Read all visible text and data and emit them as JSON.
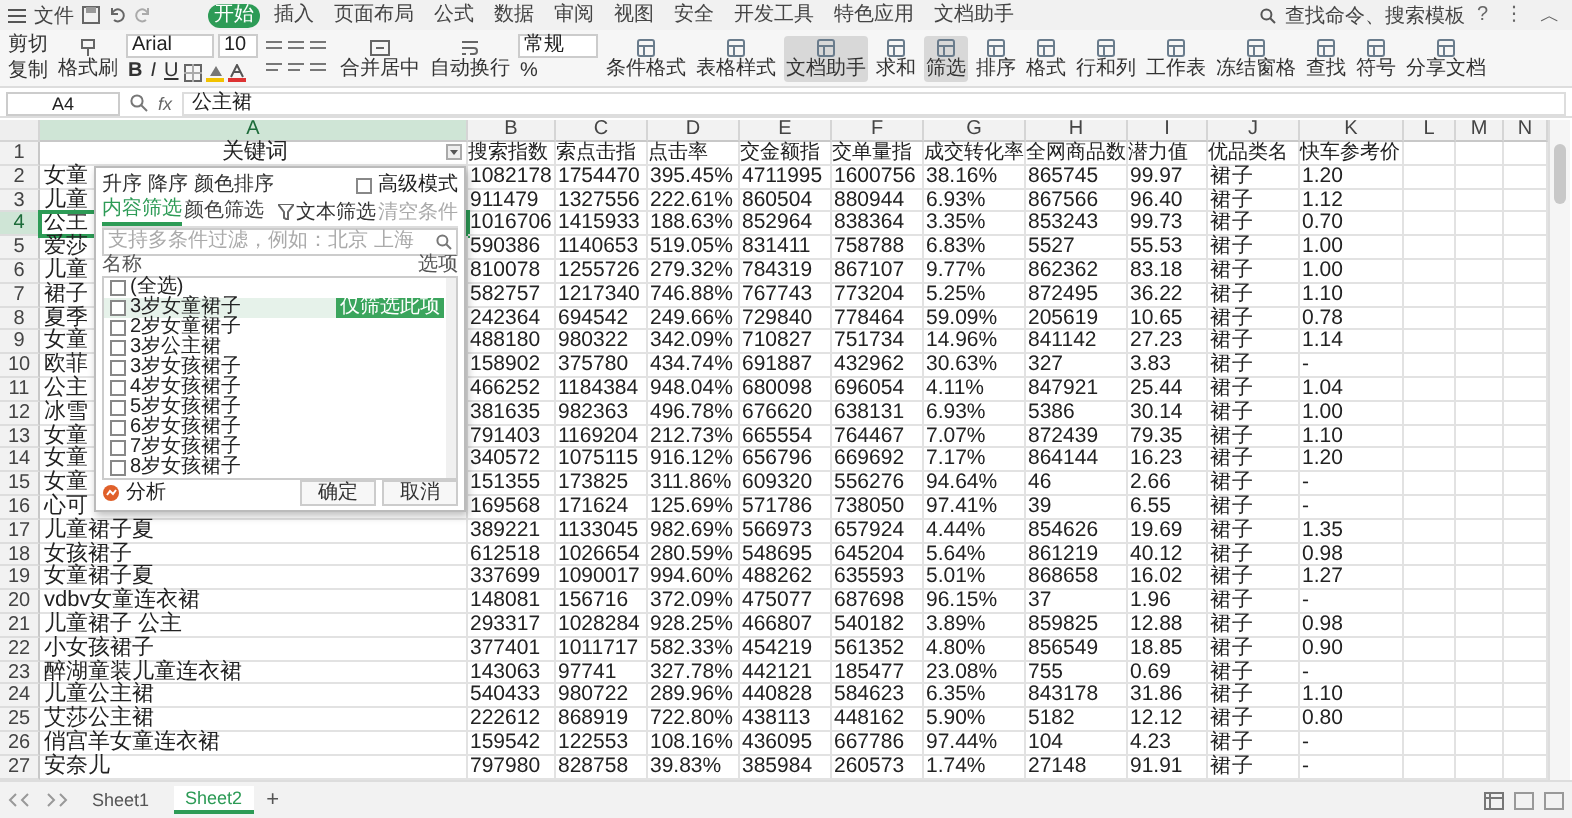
{
  "menu": {
    "file": "文件",
    "tabs": [
      {
        "label": "开始",
        "selected": true
      },
      {
        "label": "插入",
        "selected": false
      },
      {
        "label": "页面布局",
        "selected": false
      },
      {
        "label": "公式",
        "selected": false
      },
      {
        "label": "数据",
        "selected": false
      },
      {
        "label": "审阅",
        "selected": false
      },
      {
        "label": "视图",
        "selected": false
      },
      {
        "label": "安全",
        "selected": false
      },
      {
        "label": "开发工具",
        "selected": false
      },
      {
        "label": "特色应用",
        "selected": false
      },
      {
        "label": "文档助手",
        "selected": false
      }
    ],
    "search": "查找命令、搜索模板",
    "controls": [
      "?",
      "⋮",
      "︿"
    ]
  },
  "ribbon": {
    "clipboard": [
      "剪切",
      "复制"
    ],
    "format_painter": "格式刷",
    "font": {
      "name": "Arial",
      "size": "10"
    },
    "styles": [
      "B",
      "I",
      "U"
    ],
    "merge": "合并居中",
    "wrap": "自动换行",
    "number_format": "常规",
    "number_buttons": [
      "%"
    ],
    "tools": [
      {
        "label": "条件格式",
        "pressed": false
      },
      {
        "label": "表格样式",
        "pressed": false
      },
      {
        "label": "文档助手",
        "pressed": true
      },
      {
        "label": "求和",
        "pressed": false
      },
      {
        "label": "筛选",
        "pressed": true
      },
      {
        "label": "排序",
        "pressed": false
      },
      {
        "label": "格式",
        "pressed": false
      },
      {
        "label": "行和列",
        "pressed": false
      },
      {
        "label": "工作表",
        "pressed": false
      },
      {
        "label": "冻结窗格",
        "pressed": false
      },
      {
        "label": "查找",
        "pressed": false
      },
      {
        "label": "符号",
        "pressed": false
      },
      {
        "label": "分享文档",
        "pressed": false
      }
    ]
  },
  "formula_bar": {
    "name_box": "A4",
    "fx": "fx",
    "value": "公主裙"
  },
  "sheet": {
    "columns": [
      {
        "label": "A",
        "selected": true
      },
      {
        "label": "B",
        "selected": false
      },
      {
        "label": "C",
        "selected": false
      },
      {
        "label": "D",
        "selected": false
      },
      {
        "label": "E",
        "selected": false
      },
      {
        "label": "F",
        "selected": false
      },
      {
        "label": "G",
        "selected": false
      },
      {
        "label": "H",
        "selected": false
      },
      {
        "label": "I",
        "selected": false
      },
      {
        "label": "J",
        "selected": false
      },
      {
        "label": "K",
        "selected": false
      },
      {
        "label": "L",
        "selected": false
      },
      {
        "label": "M",
        "selected": false
      },
      {
        "label": "N",
        "selected": false
      }
    ],
    "rows": [
      {
        "n": "1",
        "selected": false,
        "cells": [
          "关键词",
          "搜索指数",
          "索点击指",
          "点击率",
          "交金额指",
          "交单量指",
          "成交转化率",
          "全网商品数",
          "潜力值",
          "优品类名",
          "快车参考价"
        ]
      },
      {
        "n": "2",
        "selected": false,
        "cells": [
          "女童",
          "1082178",
          "1754470",
          "395.45%",
          "4711995",
          "1600756",
          "38.16%",
          "865745",
          "99.97",
          "裙子",
          "1.20"
        ]
      },
      {
        "n": "3",
        "selected": false,
        "cells": [
          "儿童",
          "911479",
          "1327556",
          "222.61%",
          "860504",
          "880944",
          "6.93%",
          "867566",
          "96.40",
          "裙子",
          "1.12"
        ]
      },
      {
        "n": "4",
        "selected": true,
        "cells": [
          "公主",
          "1016706",
          "1415933",
          "188.63%",
          "852964",
          "838364",
          "3.35%",
          "853243",
          "99.73",
          "裙子",
          "0.70"
        ]
      },
      {
        "n": "5",
        "selected": false,
        "cells": [
          "爱莎",
          "590386",
          "1140653",
          "519.05%",
          "831411",
          "758788",
          "6.83%",
          "5527",
          "55.53",
          "裙子",
          "1.00"
        ]
      },
      {
        "n": "6",
        "selected": false,
        "cells": [
          "儿童",
          "810078",
          "1255726",
          "279.32%",
          "784319",
          "867107",
          "9.77%",
          "862362",
          "83.18",
          "裙子",
          "1.00"
        ]
      },
      {
        "n": "7",
        "selected": false,
        "cells": [
          "裙子",
          "582757",
          "1217340",
          "746.88%",
          "767743",
          "773204",
          "5.25%",
          "872495",
          "36.22",
          "裙子",
          "1.10"
        ]
      },
      {
        "n": "8",
        "selected": false,
        "cells": [
          "夏季",
          "242364",
          "694542",
          "249.66%",
          "729840",
          "778464",
          "59.09%",
          "205619",
          "10.65",
          "裙子",
          "0.78"
        ]
      },
      {
        "n": "9",
        "selected": false,
        "cells": [
          "女童",
          "488180",
          "980322",
          "342.09%",
          "710827",
          "751734",
          "14.96%",
          "841142",
          "27.23",
          "裙子",
          "1.14"
        ]
      },
      {
        "n": "10",
        "selected": false,
        "cells": [
          "欧菲",
          "158902",
          "375780",
          "434.74%",
          "691887",
          "432962",
          "30.63%",
          "327",
          "3.83",
          "裙子",
          "-"
        ]
      },
      {
        "n": "11",
        "selected": false,
        "cells": [
          "公主",
          "466252",
          "1184384",
          "948.04%",
          "680098",
          "696054",
          "4.11%",
          "847921",
          "25.44",
          "裙子",
          "1.04"
        ]
      },
      {
        "n": "12",
        "selected": false,
        "cells": [
          "冰雪",
          "381635",
          "982363",
          "496.78%",
          "676620",
          "638131",
          "6.93%",
          "5386",
          "30.14",
          "裙子",
          "1.00"
        ]
      },
      {
        "n": "13",
        "selected": false,
        "cells": [
          "女童",
          "791403",
          "1169204",
          "212.73%",
          "665554",
          "764467",
          "7.07%",
          "872439",
          "79.35",
          "裙子",
          "1.10"
        ]
      },
      {
        "n": "14",
        "selected": false,
        "cells": [
          "女童",
          "340572",
          "1075115",
          "916.12%",
          "656796",
          "669692",
          "7.17%",
          "864144",
          "16.23",
          "裙子",
          "1.20"
        ]
      },
      {
        "n": "15",
        "selected": false,
        "cells": [
          "女童",
          "151355",
          "173825",
          "311.86%",
          "609320",
          "556276",
          "94.64%",
          "46",
          "2.66",
          "裙子",
          "-"
        ]
      },
      {
        "n": "16",
        "selected": false,
        "cells": [
          "心可",
          "169568",
          "171624",
          "125.69%",
          "571786",
          "738050",
          "97.41%",
          "39",
          "6.55",
          "裙子",
          "-"
        ]
      },
      {
        "n": "17",
        "selected": false,
        "cells": [
          "儿童裙子夏",
          "389221",
          "1133045",
          "982.69%",
          "566973",
          "657924",
          "4.44%",
          "854626",
          "19.69",
          "裙子",
          "1.35"
        ]
      },
      {
        "n": "18",
        "selected": false,
        "cells": [
          "女孩裙子",
          "612518",
          "1026654",
          "280.59%",
          "548695",
          "645204",
          "5.64%",
          "861219",
          "40.12",
          "裙子",
          "0.98"
        ]
      },
      {
        "n": "19",
        "selected": false,
        "cells": [
          "女童裙子夏",
          "337699",
          "1090017",
          "994.60%",
          "488262",
          "635593",
          "5.01%",
          "868658",
          "16.02",
          "裙子",
          "1.27"
        ]
      },
      {
        "n": "20",
        "selected": false,
        "cells": [
          "vdbv女童连衣裙",
          "148081",
          "156716",
          "372.09%",
          "475077",
          "687698",
          "96.15%",
          "37",
          "1.96",
          "裙子",
          "-"
        ]
      },
      {
        "n": "21",
        "selected": false,
        "cells": [
          "儿童裙子 公主",
          "293317",
          "1028284",
          "928.25%",
          "466807",
          "540182",
          "3.89%",
          "859825",
          "12.88",
          "裙子",
          "0.98"
        ]
      },
      {
        "n": "22",
        "selected": false,
        "cells": [
          "小女孩裙子",
          "377401",
          "1011717",
          "582.33%",
          "454219",
          "561352",
          "4.80%",
          "856549",
          "18.85",
          "裙子",
          "0.90"
        ]
      },
      {
        "n": "23",
        "selected": false,
        "cells": [
          "醉湖童装儿童连衣裙",
          "143063",
          "97741",
          "327.78%",
          "442121",
          "185477",
          "23.08%",
          "755",
          "0.69",
          "裙子",
          "-"
        ]
      },
      {
        "n": "24",
        "selected": false,
        "cells": [
          "儿童公主裙",
          "540433",
          "980722",
          "289.96%",
          "440828",
          "584623",
          "6.35%",
          "843178",
          "31.86",
          "裙子",
          "1.10"
        ]
      },
      {
        "n": "25",
        "selected": false,
        "cells": [
          "艾莎公主裙",
          "222612",
          "868919",
          "722.80%",
          "438113",
          "448162",
          "5.90%",
          "5182",
          "12.12",
          "裙子",
          "0.80"
        ]
      },
      {
        "n": "26",
        "selected": false,
        "cells": [
          "俏宫羊女童连衣裙",
          "159542",
          "122553",
          "108.16%",
          "436095",
          "667786",
          "97.44%",
          "104",
          "4.23",
          "裙子",
          "-"
        ]
      },
      {
        "n": "27",
        "selected": false,
        "cells": [
          "安奈儿",
          "797980",
          "828758",
          "39.83%",
          "385984",
          "260573",
          "1.74%",
          "27148",
          "91.91",
          "裙子",
          "-"
        ]
      }
    ]
  },
  "filter_popup": {
    "sort": [
      "升序",
      "降序",
      "颜色排序"
    ],
    "advanced": {
      "label": "高级模式",
      "checked": false
    },
    "tabs": [
      {
        "label": "内容筛选",
        "selected": true
      },
      {
        "label": "颜色筛选",
        "selected": false
      }
    ],
    "text_filter": "文本筛选",
    "clear": {
      "label": "清空条件",
      "disabled": true
    },
    "placeholder": "支持多条件过滤，例如：北京 上海",
    "list_header": [
      "名称",
      "选项"
    ],
    "items": [
      {
        "label": "(全选)",
        "checked": false,
        "hover": false
      },
      {
        "label": "3岁女童裙子",
        "checked": false,
        "hover": true
      },
      {
        "label": "2岁女童裙子",
        "checked": false,
        "hover": false
      },
      {
        "label": "3岁公主裙",
        "checked": false,
        "hover": false
      },
      {
        "label": "3岁女孩裙子",
        "checked": false,
        "hover": false
      },
      {
        "label": "4岁女孩裙子",
        "checked": false,
        "hover": false
      },
      {
        "label": "5岁女孩裙子",
        "checked": false,
        "hover": false
      },
      {
        "label": "6岁女孩裙子",
        "checked": false,
        "hover": false
      },
      {
        "label": "7岁女孩裙子",
        "checked": false,
        "hover": false
      },
      {
        "label": "8岁女孩裙子",
        "checked": false,
        "hover": false
      }
    ],
    "hover_tag": "仅筛选此项",
    "analyze": "分析",
    "buttons": [
      "确定",
      "取消"
    ]
  },
  "sheet_tabs": [
    {
      "label": "Sheet1",
      "selected": false
    },
    {
      "label": "Sheet2",
      "selected": true
    }
  ],
  "add_sheet": "+"
}
